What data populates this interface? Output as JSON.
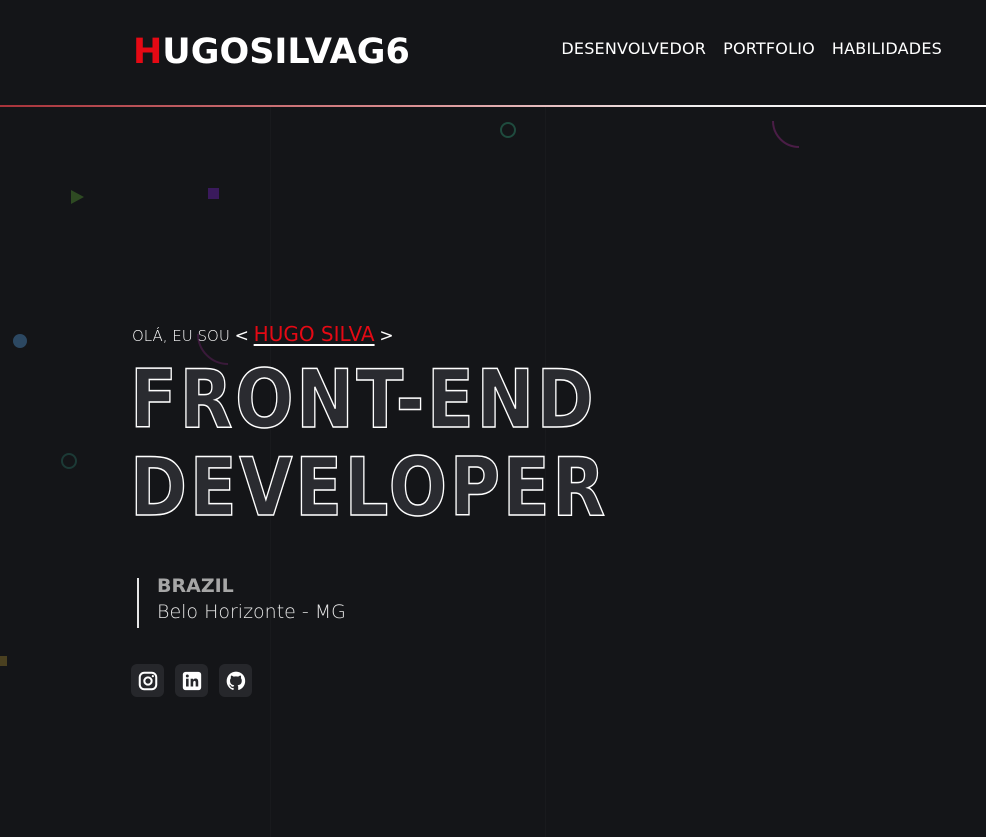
{
  "header": {
    "logo_first_letter": "H",
    "logo_rest": "UGOSILVAG6",
    "nav": [
      {
        "label": "DESENVOLVEDOR"
      },
      {
        "label": "PORTFOLIO"
      },
      {
        "label": "HABILIDADES"
      }
    ]
  },
  "hero": {
    "greeting_prefix": "OLÁ, EU SOU",
    "open_bracket": "<",
    "name": "HUGO SILVA",
    "close_bracket": ">",
    "title_line1": "FRONT-END",
    "title_line2": "DEVELOPER"
  },
  "location": {
    "country": "BRAZIL",
    "city": "Belo Horizonte - MG"
  },
  "socials": [
    {
      "icon": "instagram-icon"
    },
    {
      "icon": "linkedin-icon"
    },
    {
      "icon": "github-icon"
    }
  ],
  "colors": {
    "background": "#141518",
    "accent": "#e50914",
    "text": "#ffffff"
  }
}
